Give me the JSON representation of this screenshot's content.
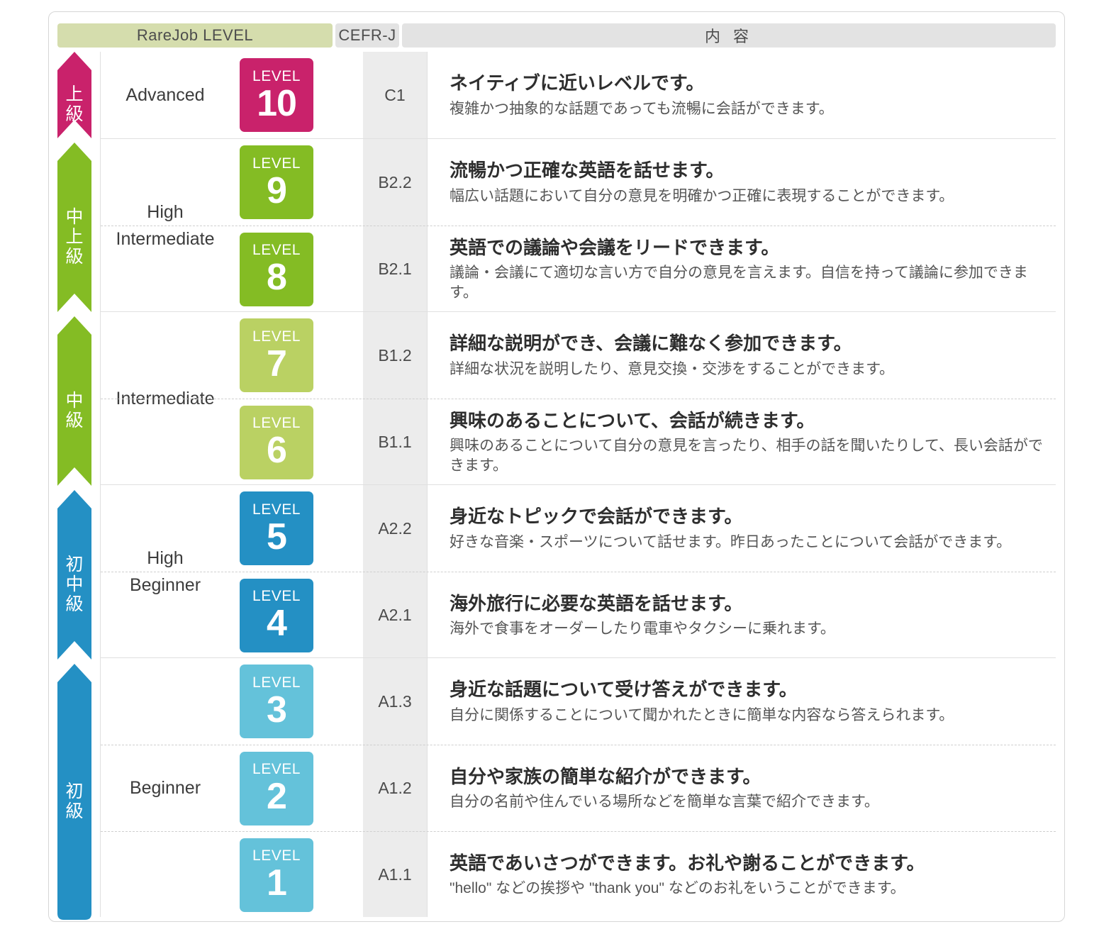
{
  "header": {
    "rarejob_level": "RareJob LEVEL",
    "cefr_j": "CEFR-J",
    "content": "内 容"
  },
  "ribbon": {
    "segments": [
      {
        "label": "上\n級",
        "color": "#c9226b",
        "name": "advanced"
      },
      {
        "label": "中\n上\n級",
        "color": "#84bc24",
        "name": "high-intermediate"
      },
      {
        "label": "中\n級",
        "color": "#84bc24",
        "name": "intermediate"
      },
      {
        "label": "初\n中\n級",
        "color": "#2490c4",
        "name": "high-beginner"
      },
      {
        "label": "初\n級",
        "color": "#2490c4",
        "name": "beginner"
      }
    ]
  },
  "bands": [
    {
      "name": "Advanced",
      "rows": [
        {
          "level_word": "LEVEL",
          "level_num": "10",
          "badge_color": "#c9226b",
          "cefr": "C1",
          "title": "ネイティブに近いレベルです。",
          "sub": "複雑かつ抽象的な話題であっても流暢に会話ができます。"
        }
      ]
    },
    {
      "name": "High\nIntermediate",
      "rows": [
        {
          "level_word": "LEVEL",
          "level_num": "9",
          "badge_color": "#84bc24",
          "cefr": "B2.2",
          "title": "流暢かつ正確な英語を話せます。",
          "sub": "幅広い話題において自分の意見を明確かつ正確に表現することができます。"
        },
        {
          "level_word": "LEVEL",
          "level_num": "8",
          "badge_color": "#84bc24",
          "cefr": "B2.1",
          "title": "英語での議論や会議をリードできます。",
          "sub": "議論・会議にて適切な言い方で自分の意見を言えます。自信を持って議論に参加できます。"
        }
      ]
    },
    {
      "name": "Intermediate",
      "rows": [
        {
          "level_word": "LEVEL",
          "level_num": "7",
          "badge_color": "#bad163",
          "cefr": "B1.2",
          "title": "詳細な説明ができ、会議に難なく参加できます。",
          "sub": "詳細な状況を説明したり、意見交換・交渉をすることができます。"
        },
        {
          "level_word": "LEVEL",
          "level_num": "6",
          "badge_color": "#bad163",
          "cefr": "B1.1",
          "title": "興味のあることについて、会話が続きます。",
          "sub": "興味のあることについて自分の意見を言ったり、相手の話を聞いたりして、長い会話ができます。"
        }
      ]
    },
    {
      "name": "High\nBeginner",
      "rows": [
        {
          "level_word": "LEVEL",
          "level_num": "5",
          "badge_color": "#2490c4",
          "cefr": "A2.2",
          "title": "身近なトピックで会話ができます。",
          "sub": "好きな音楽・スポーツについて話せます。昨日あったことについて会話ができます。"
        },
        {
          "level_word": "LEVEL",
          "level_num": "4",
          "badge_color": "#2490c4",
          "cefr": "A2.1",
          "title": "海外旅行に必要な英語を話せます。",
          "sub": "海外で食事をオーダーしたり電車やタクシーに乗れます。"
        }
      ]
    },
    {
      "name": "Beginner",
      "rows": [
        {
          "level_word": "LEVEL",
          "level_num": "3",
          "badge_color": "#64c2da",
          "cefr": "A1.3",
          "title": "身近な話題について受け答えができます。",
          "sub": "自分に関係することについて聞かれたときに簡単な内容なら答えられます。"
        },
        {
          "level_word": "LEVEL",
          "level_num": "2",
          "badge_color": "#64c2da",
          "cefr": "A1.2",
          "title": "自分や家族の簡単な紹介ができます。",
          "sub": "自分の名前や住んでいる場所などを簡単な言葉で紹介できます。"
        },
        {
          "level_word": "LEVEL",
          "level_num": "1",
          "badge_color": "#64c2da",
          "cefr": "A1.1",
          "title": "英語であいさつができます。お礼や謝ることができます。",
          "sub": "\"hello\" などの挨拶や \"thank you\" などのお礼をいうことができます。"
        }
      ]
    }
  ]
}
